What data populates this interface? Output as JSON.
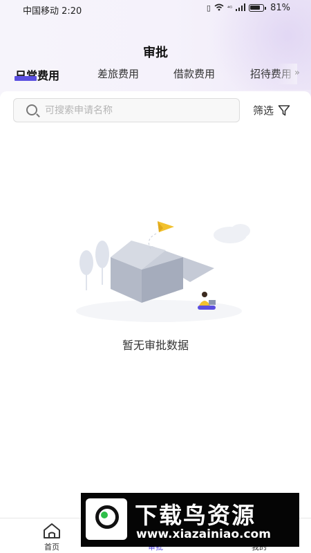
{
  "status_bar": {
    "carrier_time": "中国移动 2:20",
    "battery": "81%",
    "icons": [
      "vibrate-icon",
      "wifi-icon",
      "4g-icon",
      "signal-icon",
      "battery-icon"
    ]
  },
  "page": {
    "title": "审批"
  },
  "tabs": [
    {
      "label": "日常费用",
      "active": true
    },
    {
      "label": "差旅费用",
      "active": false
    },
    {
      "label": "借款费用",
      "active": false
    },
    {
      "label": "招待费用",
      "active": false
    }
  ],
  "tabs_more": "»",
  "search": {
    "placeholder": "可搜索申请名称",
    "value": ""
  },
  "filter": {
    "label": "筛选",
    "icon": "filter-icon"
  },
  "empty_state": {
    "text": "暂无审批数据",
    "icon": "empty-box-illustration"
  },
  "tabbar": [
    {
      "label": "首页",
      "icon": "home-icon",
      "active": false
    },
    {
      "label": "审批",
      "icon": "approval-icon",
      "active": true
    },
    {
      "label": "我的",
      "icon": "profile-icon",
      "active": false
    }
  ],
  "watermark": {
    "title": "下载鸟资源",
    "url": "www.xiazainiao.com"
  },
  "colors": {
    "accent": "#5b4fe0",
    "background": "#ffffff",
    "header_tint": "#f4f1fa"
  }
}
